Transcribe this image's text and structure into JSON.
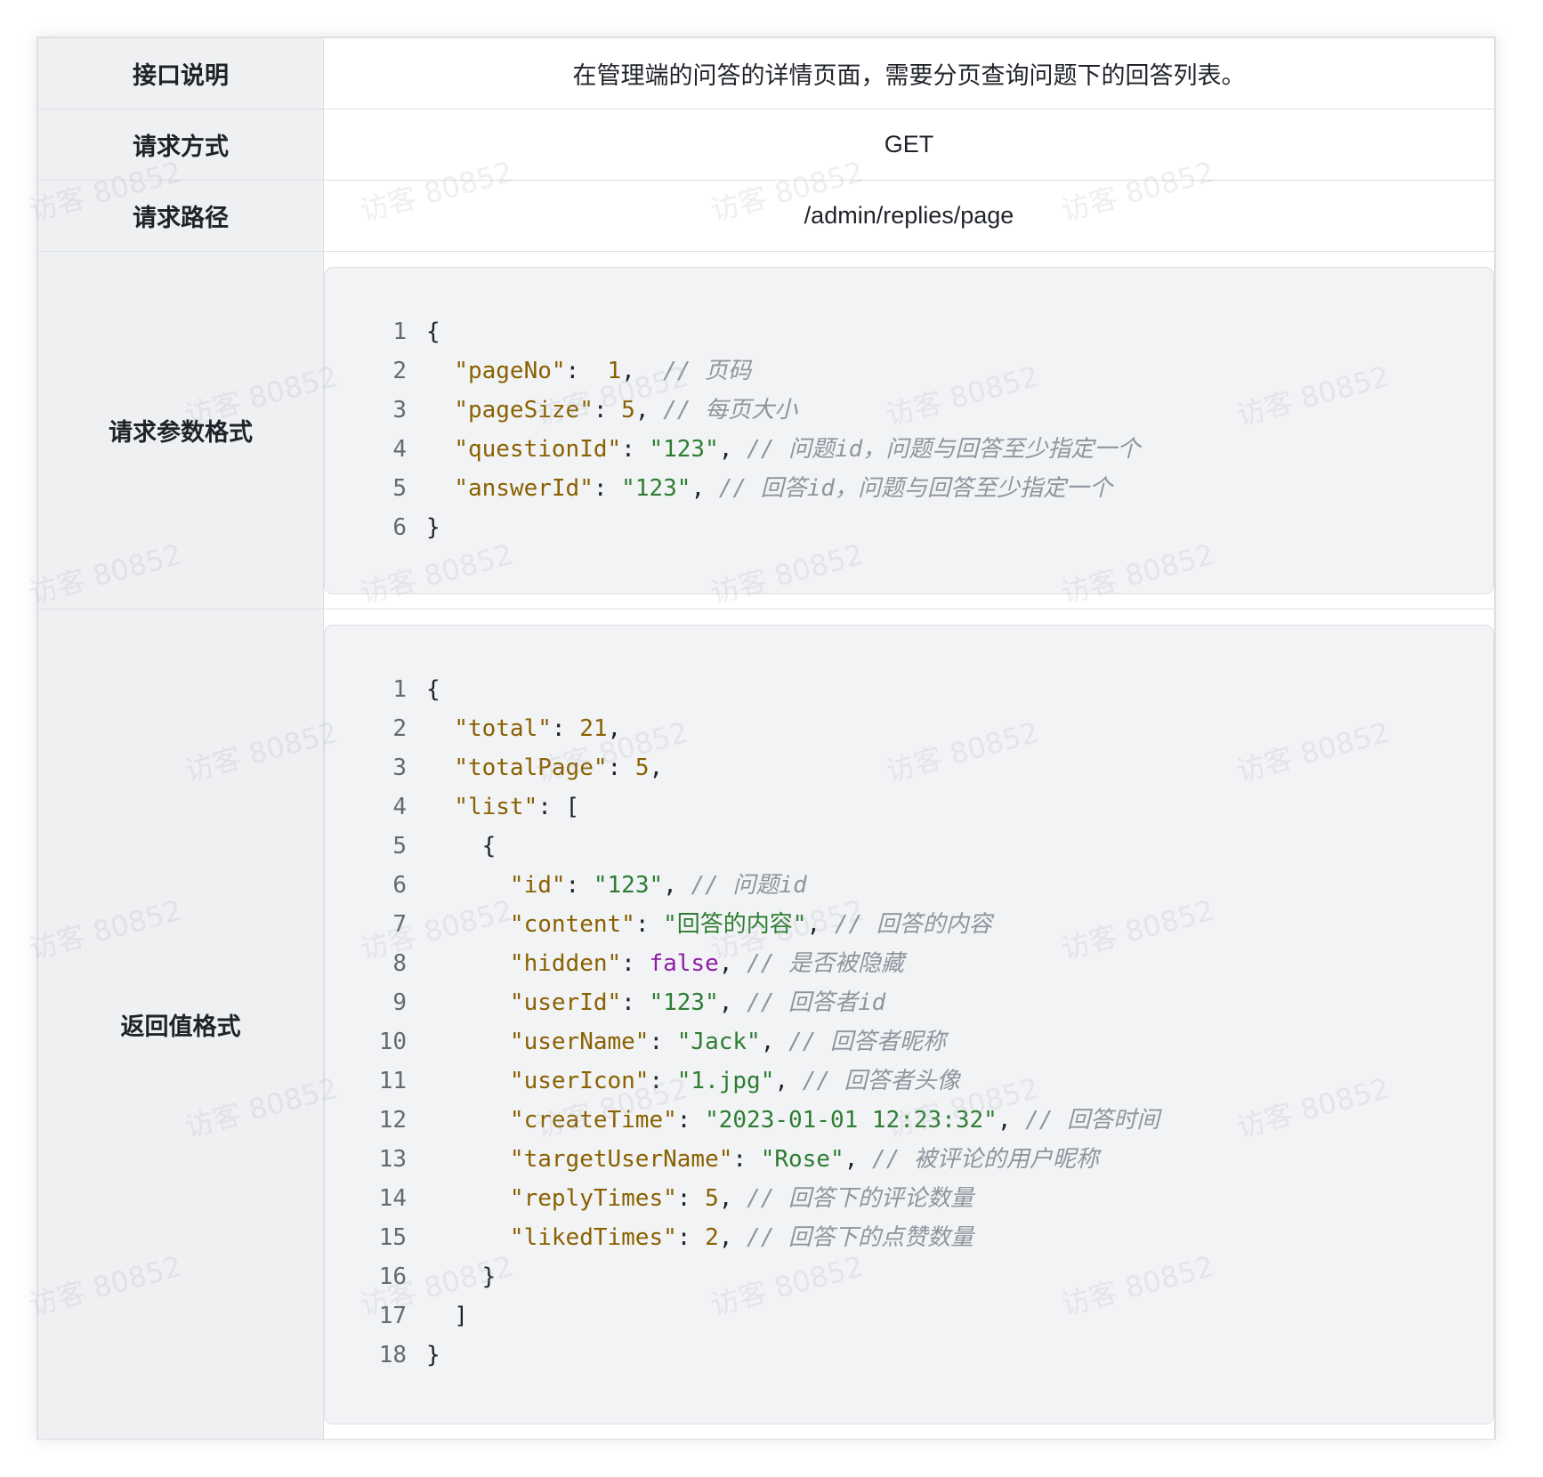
{
  "rows": {
    "desc": {
      "label": "接口说明",
      "value": "在管理端的问答的详情页面，需要分页查询问题下的回答列表。"
    },
    "method": {
      "label": "请求方式",
      "value": "GET"
    },
    "path": {
      "label": "请求路径",
      "value": "/admin/replies/page"
    },
    "request": {
      "label": "请求参数格式"
    },
    "response": {
      "label": "返回值格式"
    }
  },
  "request_code": [
    [
      [
        "p",
        "{"
      ]
    ],
    [
      [
        "p",
        "  "
      ],
      [
        "k",
        "\"pageNo\""
      ],
      [
        "p",
        ":  "
      ],
      [
        "n",
        "1"
      ],
      [
        "p",
        ",  "
      ],
      [
        "c",
        "// 页码"
      ]
    ],
    [
      [
        "p",
        "  "
      ],
      [
        "k",
        "\"pageSize\""
      ],
      [
        "p",
        ": "
      ],
      [
        "n",
        "5"
      ],
      [
        "p",
        ", "
      ],
      [
        "c",
        "// 每页大小"
      ]
    ],
    [
      [
        "p",
        "  "
      ],
      [
        "k",
        "\"questionId\""
      ],
      [
        "p",
        ": "
      ],
      [
        "s",
        "\"123\""
      ],
      [
        "p",
        ", "
      ],
      [
        "c",
        "// 问题id，问题与回答至少指定一个"
      ]
    ],
    [
      [
        "p",
        "  "
      ],
      [
        "k",
        "\"answerId\""
      ],
      [
        "p",
        ": "
      ],
      [
        "s",
        "\"123\""
      ],
      [
        "p",
        ", "
      ],
      [
        "c",
        "// 回答id，问题与回答至少指定一个"
      ]
    ],
    [
      [
        "p",
        "}"
      ]
    ]
  ],
  "response_code": [
    [
      [
        "p",
        "{"
      ]
    ],
    [
      [
        "p",
        "  "
      ],
      [
        "k",
        "\"total\""
      ],
      [
        "p",
        ": "
      ],
      [
        "n",
        "21"
      ],
      [
        "p",
        ","
      ]
    ],
    [
      [
        "p",
        "  "
      ],
      [
        "k",
        "\"totalPage\""
      ],
      [
        "p",
        ": "
      ],
      [
        "n",
        "5"
      ],
      [
        "p",
        ","
      ]
    ],
    [
      [
        "p",
        "  "
      ],
      [
        "k",
        "\"list\""
      ],
      [
        "p",
        ": ["
      ]
    ],
    [
      [
        "p",
        "    {"
      ]
    ],
    [
      [
        "p",
        "      "
      ],
      [
        "k",
        "\"id\""
      ],
      [
        "p",
        ": "
      ],
      [
        "s",
        "\"123\""
      ],
      [
        "p",
        ", "
      ],
      [
        "c",
        "// 问题id"
      ]
    ],
    [
      [
        "p",
        "      "
      ],
      [
        "k",
        "\"content\""
      ],
      [
        "p",
        ": "
      ],
      [
        "s",
        "\"回答的内容\""
      ],
      [
        "p",
        ", "
      ],
      [
        "c",
        "// 回答的内容"
      ]
    ],
    [
      [
        "p",
        "      "
      ],
      [
        "k",
        "\"hidden\""
      ],
      [
        "p",
        ": "
      ],
      [
        "b",
        "false"
      ],
      [
        "p",
        ", "
      ],
      [
        "c",
        "// 是否被隐藏"
      ]
    ],
    [
      [
        "p",
        "      "
      ],
      [
        "k",
        "\"userId\""
      ],
      [
        "p",
        ": "
      ],
      [
        "s",
        "\"123\""
      ],
      [
        "p",
        ", "
      ],
      [
        "c",
        "// 回答者id"
      ]
    ],
    [
      [
        "p",
        "      "
      ],
      [
        "k",
        "\"userName\""
      ],
      [
        "p",
        ": "
      ],
      [
        "s",
        "\"Jack\""
      ],
      [
        "p",
        ", "
      ],
      [
        "c",
        "// 回答者昵称"
      ]
    ],
    [
      [
        "p",
        "      "
      ],
      [
        "k",
        "\"userIcon\""
      ],
      [
        "p",
        ": "
      ],
      [
        "s",
        "\"1.jpg\""
      ],
      [
        "p",
        ", "
      ],
      [
        "c",
        "// 回答者头像"
      ]
    ],
    [
      [
        "p",
        "      "
      ],
      [
        "k",
        "\"createTime\""
      ],
      [
        "p",
        ": "
      ],
      [
        "s",
        "\"2023-01-01 12:23:32\""
      ],
      [
        "p",
        ", "
      ],
      [
        "c",
        "// 回答时间"
      ]
    ],
    [
      [
        "p",
        "      "
      ],
      [
        "k",
        "\"targetUserName\""
      ],
      [
        "p",
        ": "
      ],
      [
        "s",
        "\"Rose\""
      ],
      [
        "p",
        ", "
      ],
      [
        "c",
        "// 被评论的用户昵称"
      ]
    ],
    [
      [
        "p",
        "      "
      ],
      [
        "k",
        "\"replyTimes\""
      ],
      [
        "p",
        ": "
      ],
      [
        "n",
        "5"
      ],
      [
        "p",
        ", "
      ],
      [
        "c",
        "// 回答下的评论数量"
      ]
    ],
    [
      [
        "p",
        "      "
      ],
      [
        "k",
        "\"likedTimes\""
      ],
      [
        "p",
        ": "
      ],
      [
        "n",
        "2"
      ],
      [
        "p",
        ", "
      ],
      [
        "c",
        "// 回答下的点赞数量"
      ]
    ],
    [
      [
        "p",
        "    }"
      ]
    ],
    [
      [
        "p",
        "  ]"
      ]
    ],
    [
      [
        "p",
        "}"
      ]
    ]
  ],
  "watermark": "访客 80852",
  "colors": {
    "key": "#8a6100",
    "number": "#8a6100",
    "string": "#2e7d32",
    "boolean": "#8e1ca6",
    "comment": "#8f959e",
    "label_bg": "#eff0f2",
    "code_bg": "#f2f3f5"
  }
}
